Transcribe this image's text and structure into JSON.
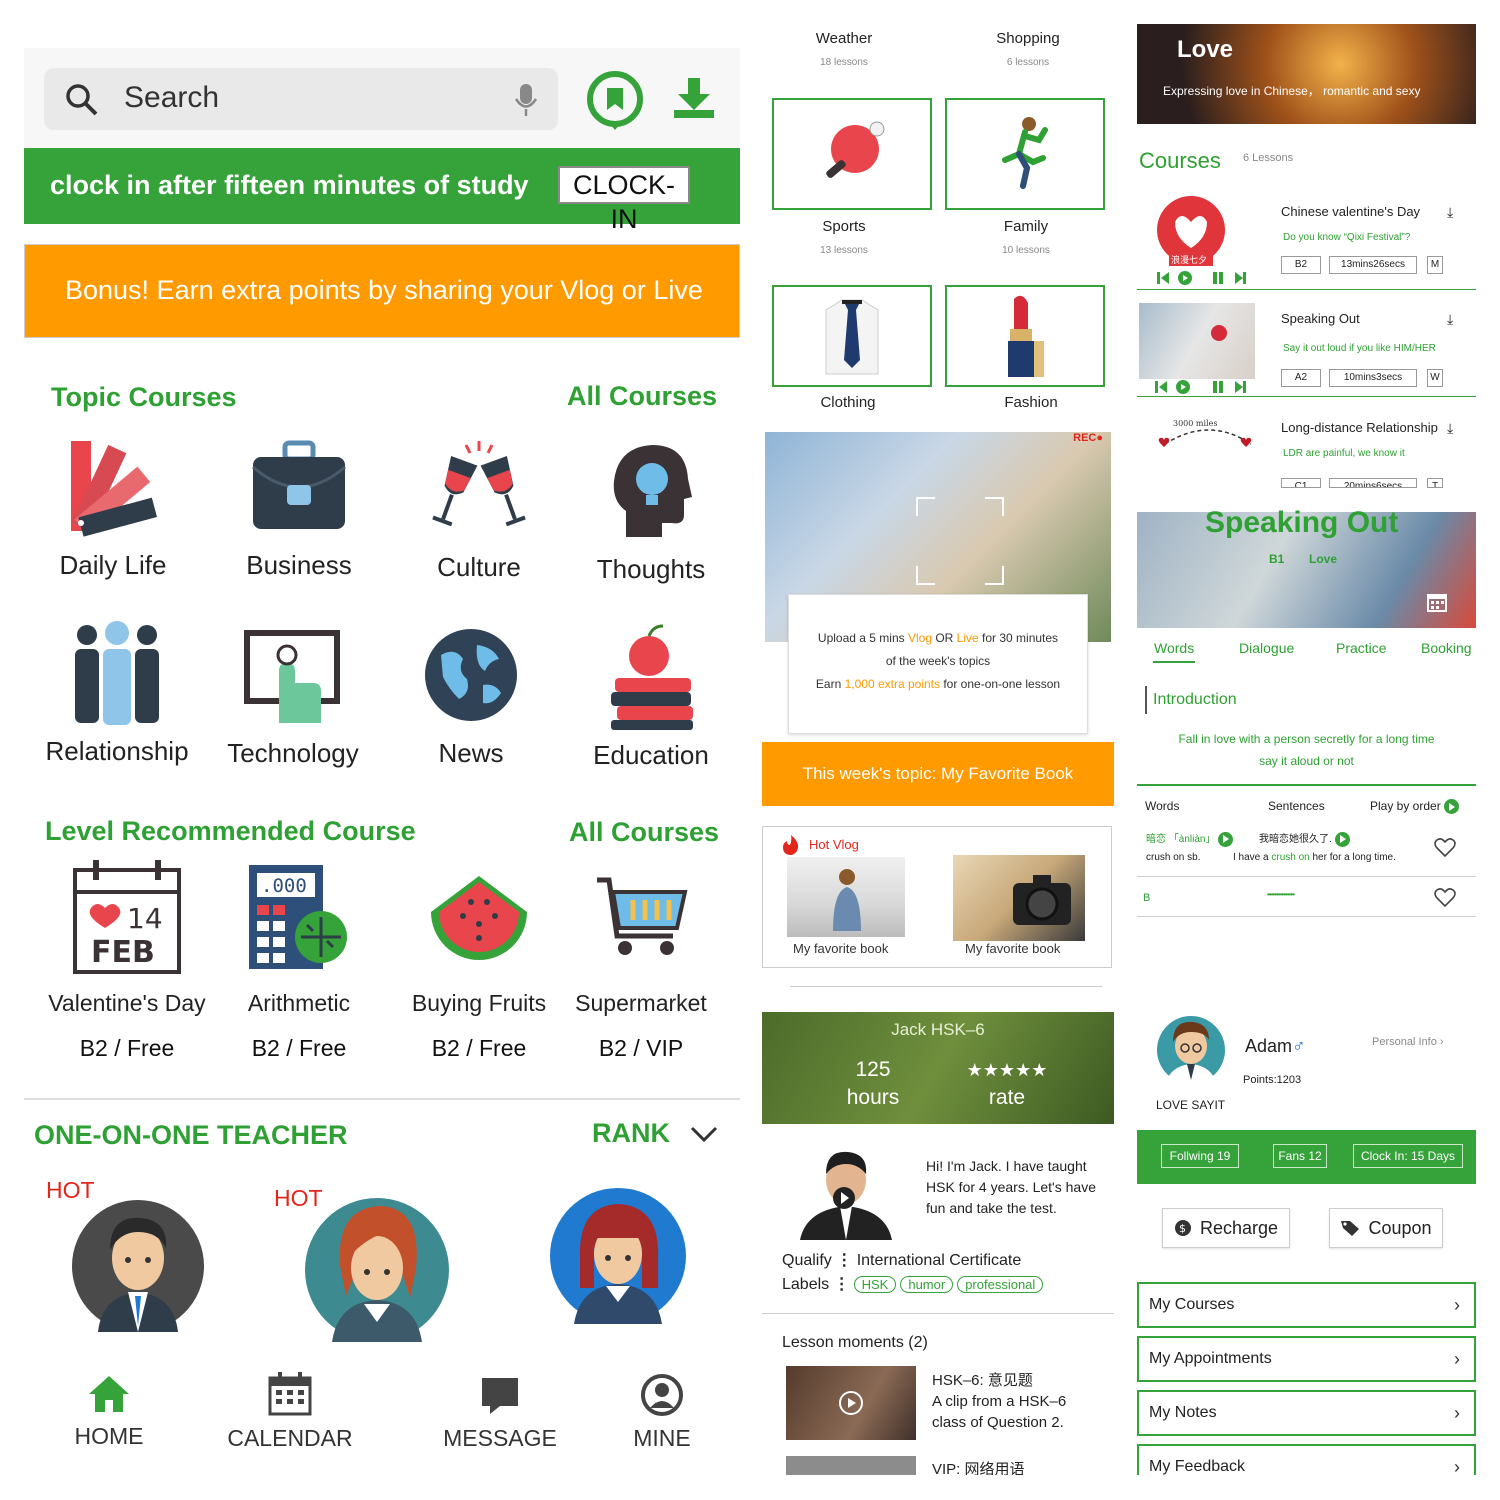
{
  "col1": {
    "search_placeholder": "Search",
    "clock_msg": "clock in after fifteen minutes of study",
    "clock_btn": "CLOCK-IN",
    "bonus": "Bonus!  Earn extra points by sharing your Vlog or Live",
    "topic_title": "Topic Courses",
    "all_courses": "All Courses",
    "topics": [
      "Daily Life",
      "Business",
      "Culture",
      "Thoughts",
      "Relationship",
      "Technology",
      "News",
      "Education"
    ],
    "level_title": "Level Recommended Courses",
    "level_courses": [
      {
        "name": "Valentine's Day",
        "level": "B2 / Free"
      },
      {
        "name": "Arithmetic",
        "level": "B2 / Free"
      },
      {
        "name": "Buying Fruits",
        "level": "B2 / Free"
      },
      {
        "name": "Supermarket",
        "level": "B2 / VIP"
      }
    ],
    "calendar_icon_day": "14",
    "calendar_icon_month": "FEB",
    "calc_display": ".000",
    "teacher_title": "ONE-ON-ONE TEACHER",
    "rank": "RANK",
    "hot": "HOT",
    "tabs": [
      "HOME",
      "CALENDAR",
      "MESSAGE",
      "MINE"
    ]
  },
  "col2": {
    "categories": [
      {
        "name": "Weather",
        "lessons": "18 lessons"
      },
      {
        "name": "Shopping",
        "lessons": "6 lessons"
      },
      {
        "name": "Sports",
        "lessons": "13 lessons"
      },
      {
        "name": "Family",
        "lessons": "10 lessons"
      },
      {
        "name": "Clothing",
        "lessons": ""
      },
      {
        "name": "Fashion",
        "lessons": ""
      }
    ],
    "rec_badge": "REC●",
    "upload": {
      "l1a": "Upload a 5 mins ",
      "vlog": "Vlog",
      "or": " OR ",
      "live": "Live",
      "l1b": " for 30 minutes",
      "l2": "of the week's topics",
      "l3a": "Earn ",
      "points": "1,000 extra points",
      "l3b": " for one-on-one lesson"
    },
    "topic_bar": "This week's topic: My Favorite Book",
    "hot_vlog": "Hot Vlog",
    "vlog_captions": [
      "My favorite book",
      "My favorite book"
    ],
    "teacher": {
      "name": "Jack  HSK–6",
      "hours_num": "125",
      "hours_lbl": "hours",
      "stars": "★★★★★",
      "rate_lbl": "rate"
    },
    "bio": "Hi! I'm Jack. I have taught HSK for 4 years. Let's have fun and take the test.",
    "qualify_lbl": "Qualify",
    "qualify_val": "International Certificate",
    "labels_lbl": "Labels",
    "labels": [
      "HSK",
      "humor",
      "professional"
    ],
    "moments_title": "Lesson moments (2)",
    "moment1_title": "HSK–6: 意见题",
    "moment1_desc": "A clip from a HSK–6 class of Question 2.",
    "moment2_title": "VIP: 网络用语"
  },
  "col3": {
    "banner_title": "Love",
    "banner_sub": "Expressing love in Chinese， romantic and sexy",
    "courses_title": "Courses",
    "courses_count": "6 Lessons",
    "courses": [
      {
        "title": "Chinese valentine's Day",
        "sub": "Do you know “Qixi Festival”?",
        "level": "B2",
        "dur": "13mins26secs",
        "tag": "M"
      },
      {
        "title": "Speaking Out",
        "sub": "Say it out loud if you like HIM/HER",
        "level": "A2",
        "dur": "10mins3secs",
        "tag": "W"
      },
      {
        "title": "Long-distance Relationship",
        "sub": "LDR are painful, we know it",
        "level": "C1",
        "dur": "20mins6secs",
        "tag": "T"
      }
    ],
    "thumb_badge": "浪漫七夕",
    "miles_label": "3000 miles",
    "speak_title": "Speaking Out",
    "speak_level": "B1",
    "speak_topic": "Love",
    "tabs": [
      "Words",
      "Dialogue",
      "Practice",
      "Booking"
    ],
    "intro": "Introduction",
    "intro_l1": "Fall in love with a person secretly for a long time",
    "intro_l2": "say it aloud or not",
    "hdr_words": "Words",
    "hdr_sentences": "Sentences",
    "hdr_play": "Play by order",
    "word": "暗恋 「ànliàn」",
    "word_en": "crush on sb.",
    "sent": "我暗恋她很久了.",
    "sent_en_a": "I have a ",
    "sent_en_hl": "crush on",
    "sent_en_b": " her for a long time.",
    "row2_letter": "B",
    "row2_dots": "•••••••••••••••",
    "profile": {
      "name": "Adam",
      "gender": "♂",
      "personal": "Personal Info",
      "points": "Points:1203",
      "tagline": "LOVE SAYIT"
    },
    "stats": [
      "Follwing 19",
      "Fans 12",
      "Clock In: 15 Days"
    ],
    "recharge": "Recharge",
    "coupon": "Coupon",
    "menu": [
      "My Courses",
      "My Appointments",
      "My Notes",
      "My Feedback"
    ]
  },
  "colors": {
    "green": "#35a23a",
    "orange": "#ff9a00",
    "hot": "#e3261c"
  }
}
